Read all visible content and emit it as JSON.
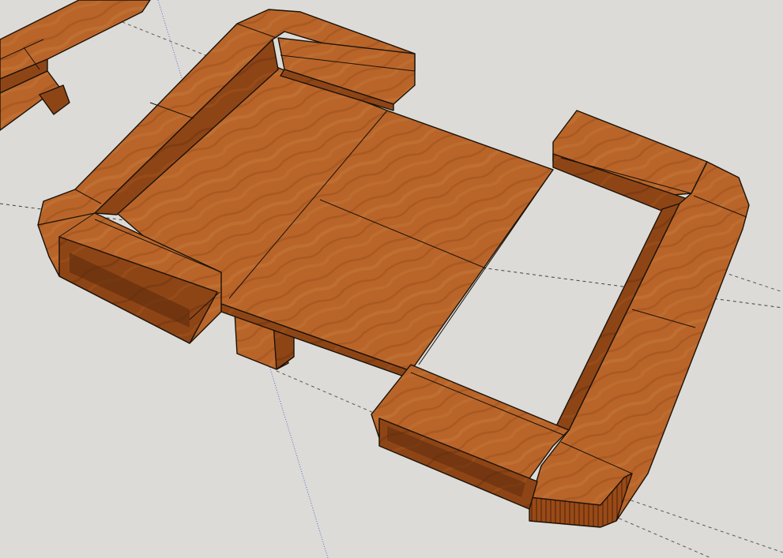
{
  "viewport": {
    "background_color": "#dcdbd8"
  },
  "scene": {
    "model": "wooden-table-with-shelves",
    "material_colors": {
      "wood_light": "#c06d2e",
      "wood_mid": "#a9581f",
      "wood_dark": "#7c3a12",
      "edge": "#1a1209"
    },
    "axes": {
      "red_axis_color": "#000000",
      "green_axis_color": "#3b4fbf"
    }
  }
}
